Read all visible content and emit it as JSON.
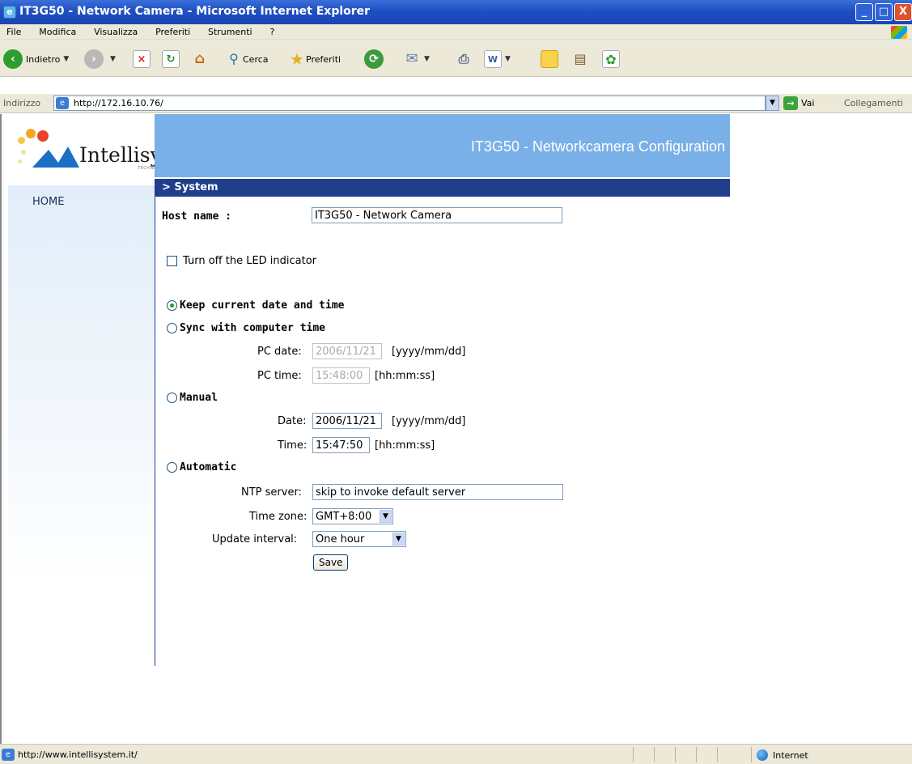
{
  "window": {
    "title": "IT3G50 - Network Camera - Microsoft Internet Explorer",
    "min_glyph": "_",
    "max_glyph": "□",
    "close_glyph": "X"
  },
  "menu": {
    "items": [
      "File",
      "Modifica",
      "Visualizza",
      "Preferiti",
      "Strumenti",
      "?"
    ]
  },
  "toolbar": {
    "back_label": "Indietro",
    "search_label": "Cerca",
    "favorites_label": "Preferiti"
  },
  "address": {
    "label": "Indirizzo",
    "url": "http://172.16.10.76/",
    "go_label": "Vai",
    "links_label": "Collegamenti"
  },
  "page": {
    "logo_text": "Intellisystem",
    "logo_sub": "TECHNOLOGIES",
    "header_title": "IT3G50 - Networkcamera Configuration",
    "nav_home": "HOME",
    "section_title": "> System"
  },
  "form": {
    "host_label": "Host name :",
    "host_value": "IT3G50 - Network Camera",
    "led_label": "Turn off the LED indicator",
    "led_checked": false,
    "keep_label": "Keep current date and time",
    "sync_label": "Sync with computer time",
    "pc_date_label": "PC date:",
    "pc_date_value": "2006/11/21",
    "date_format": "[yyyy/mm/dd]",
    "pc_time_label": "PC time:",
    "pc_time_value": "15:48:00",
    "time_format": "[hh:mm:ss]",
    "manual_label": "Manual",
    "date_label": "Date:",
    "date_value": "2006/11/21",
    "time_label": "Time:",
    "time_value": "15:47:50",
    "automatic_label": "Automatic",
    "ntp_label": "NTP server:",
    "ntp_value": "skip to invoke default server",
    "tz_label": "Time zone:",
    "tz_value": "GMT+8:00",
    "interval_label": "Update interval:",
    "interval_value": "One hour",
    "save_label": "Save",
    "selected_time_mode": "keep"
  },
  "status": {
    "text": "http://www.intellisystem.it/",
    "zone": "Internet"
  },
  "colors": {
    "header_band": "#7ab0e8",
    "section_bar": "#1f3e8c"
  }
}
